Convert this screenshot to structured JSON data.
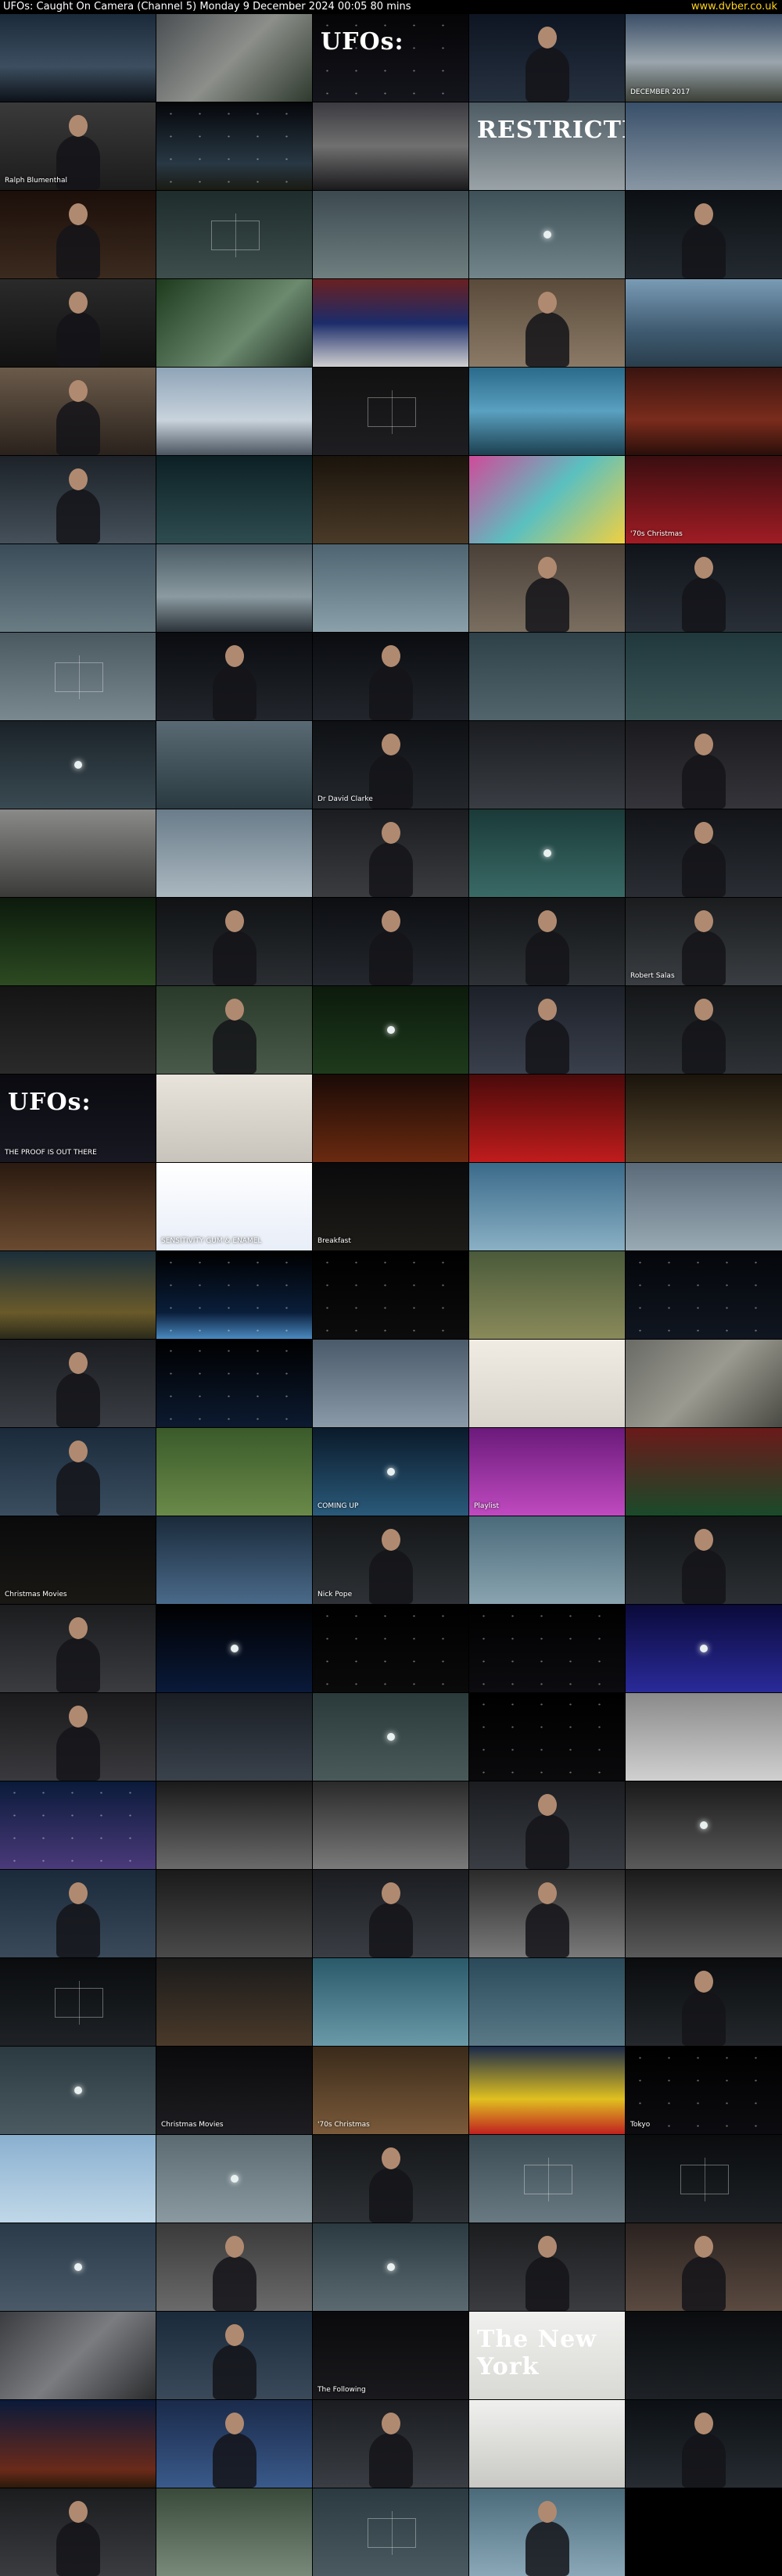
{
  "header": {
    "title": "UFOs: Caught On Camera (Channel 5)   Monday 9 December 2024  00:05  80 mins",
    "site": "www.dvber.co.uk"
  },
  "colors": {
    "background": "#000000",
    "site_link": "#ffd21e"
  },
  "thumbnails": [
    {
      "bg": "linear-gradient(#1b2a3a,#3c4e60 60%,#0d1218)"
    },
    {
      "bg": "linear-gradient(135deg,#4a4e52,#8c8f8a 50%,#2f3a2e)"
    },
    {
      "bg": "linear-gradient(#050507,#14141c)",
      "big": "UFOs:",
      "type": "stars"
    },
    {
      "bg": "linear-gradient(#0e1522,#263140)",
      "type": "person"
    },
    {
      "bg": "linear-gradient(#3a4e66,#9aa5ad 55%,#3b4036)",
      "cap": "DECEMBER 2017"
    },
    {
      "bg": "linear-gradient(#3a3a3a,#1c1c1c)",
      "type": "person",
      "cap": "Ralph Blumenthal"
    },
    {
      "bg": "linear-gradient(#05060a,#283844 70%,#1a1a12)",
      "type": "stars"
    },
    {
      "bg": "linear-gradient(#3a3a40,#707070 50%,#1a1a1d)"
    },
    {
      "bg": "linear-gradient(#4d5b63,#9aa3a7)",
      "big": "RESTRICTED"
    },
    {
      "bg": "linear-gradient(#39506a,#8997a4)"
    },
    {
      "bg": "linear-gradient(#1c0f0a,#3b2a1e)",
      "type": "person"
    },
    {
      "bg": "linear-gradient(#1e2c2c,#3d4e4c)",
      "type": "hud"
    },
    {
      "bg": "linear-gradient(#3c4a50,#6f7f80)"
    },
    {
      "bg": "linear-gradient(#3e5158,#71858a)",
      "type": "dot"
    },
    {
      "bg": "linear-gradient(#0c1014,#232a30)",
      "type": "person"
    },
    {
      "bg": "linear-gradient(#2a2a2a,#111)",
      "type": "person"
    },
    {
      "bg": "linear-gradient(135deg,#1d3a1d,#6b8a6e 60%,#1f2e22)"
    },
    {
      "bg": "linear-gradient(#6a2020,#1c2c6a 50%,#d0d0d0)"
    },
    {
      "bg": "linear-gradient(#5a4a3a,#8a7a66)",
      "type": "person"
    },
    {
      "bg": "linear-gradient(#7a9bb5,#3e5a70 60%,#2a3e4c)"
    },
    {
      "bg": "linear-gradient(#6a5a4a,#2a221c)",
      "type": "person"
    },
    {
      "bg": "linear-gradient(#8fa4b8,#c8d3dc 60%,#4a5560)"
    },
    {
      "bg": "linear-gradient(#111,#1e1e22)",
      "type": "hud"
    },
    {
      "bg": "linear-gradient(#2a6a8a,#5aa0c0 50%,#1c4050)"
    },
    {
      "bg": "linear-gradient(#3a1410,#7a2c1c 60%,#2a0e0a)"
    },
    {
      "bg": "linear-gradient(#1c2228,#45505a)",
      "type": "person"
    },
    {
      "bg": "linear-gradient(#0c2024,#2e4c50)"
    },
    {
      "bg": "linear-gradient(#1a140c,#4a3a28)"
    },
    {
      "bg": "linear-gradient(135deg,#d04a9a,#5ac0c0 50%,#f0d040)"
    },
    {
      "bg": "linear-gradient(#3a0e10,#a01c24)",
      "cap": "'70s Christmas"
    },
    {
      "bg": "linear-gradient(#3a4c58,#6a7c84)"
    },
    {
      "bg": "linear-gradient(#4a5a64,#8a9aa0 60%,#2c343a)"
    },
    {
      "bg": "linear-gradient(#4e6470,#8aa0aa)"
    },
    {
      "bg": "linear-gradient(#4a4038,#7a6e60)",
      "type": "person"
    },
    {
      "bg": "linear-gradient(#10141a,#2a3038)",
      "type": "person"
    },
    {
      "bg": "linear-gradient(#4a5860,#7a8890)",
      "type": "hud"
    },
    {
      "bg": "linear-gradient(#0a0c10,#22262c)",
      "type": "person"
    },
    {
      "bg": "linear-gradient(#0a0c10,#22262c)",
      "type": "person"
    },
    {
      "bg": "linear-gradient(#2e4048,#52646c)"
    },
    {
      "bg": "linear-gradient(#20383c,#3c5658)"
    },
    {
      "bg": "linear-gradient(#1a2228,#3a4a52)",
      "type": "dot"
    },
    {
      "bg": "linear-gradient(#5a6a74,#2a3a40)"
    },
    {
      "bg": "linear-gradient(#0e1014,#24282c)",
      "type": "person",
      "cap": "Dr David Clarke"
    },
    {
      "bg": "linear-gradient(#1a1c20,#3a3e44)"
    },
    {
      "bg": "linear-gradient(#1a1a1e,#34343a)",
      "type": "person"
    },
    {
      "bg": "linear-gradient(#8a8a88,#3a3a38)"
    },
    {
      "bg": "linear-gradient(#6a7c8a,#aab8c0)"
    },
    {
      "bg": "linear-gradient(#1a1c20,#3a3c40)",
      "type": "person"
    },
    {
      "bg": "linear-gradient(#1a3a38,#3a6a66)",
      "type": "dot"
    },
    {
      "bg": "linear-gradient(#121418,#2a2e34)",
      "type": "person"
    },
    {
      "bg": "linear-gradient(#0c1a0c,#2c4a22)"
    },
    {
      "bg": "linear-gradient(#101214,#2a2e32)",
      "type": "person"
    },
    {
      "bg": "linear-gradient(#0c0e12,#24282e)",
      "type": "person"
    },
    {
      "bg": "linear-gradient(#121416,#2e3236)",
      "type": "person"
    },
    {
      "bg": "linear-gradient(#1a1c1e,#3a3e42)",
      "type": "person",
      "cap": "Robert Salas"
    },
    {
      "bg": "linear-gradient(#141414,#2a2a2a)"
    },
    {
      "bg": "linear-gradient(#2a3a2a,#4a5a4a)",
      "type": "person"
    },
    {
      "bg": "linear-gradient(#0c1a0c,#1e3a1c)",
      "type": "dot"
    },
    {
      "bg": "linear-gradient(#1c2028,#3a404c)",
      "type": "person"
    },
    {
      "bg": "linear-gradient(#141618,#2e3236)",
      "type": "person"
    },
    {
      "bg": "linear-gradient(#0a0a10,#181822)",
      "big": "UFOs:",
      "cap": "THE PROOF IS OUT THERE"
    },
    {
      "bg": "linear-gradient(#e8e4dc,#c8c4bc)"
    },
    {
      "bg": "linear-gradient(#1a0a06,#6a2a10)"
    },
    {
      "bg": "linear-gradient(#4a0a0a,#c01c1c)"
    },
    {
      "bg": "linear-gradient(#1a140c,#5a4a30)"
    },
    {
      "bg": "linear-gradient(#2a1a10,#6a4a30)"
    },
    {
      "bg": "linear-gradient(#ffffff,#e8eef8)",
      "cap": "SENSITIVITY GUM & ENAMEL"
    },
    {
      "bg": "linear-gradient(#0a0a0c,#1e1c18)",
      "cap": "Breakfast"
    },
    {
      "bg": "linear-gradient(#3a6a8a,#8ab0c4)"
    },
    {
      "bg": "linear-gradient(#5a6a78,#9aaab4)"
    },
    {
      "bg": "linear-gradient(#1a2e3a,#6a5a2a 70%,#2a2a1a)"
    },
    {
      "bg": "linear-gradient(#000,#0a1e3a 70%,#4a8ac0)",
      "type": "stars"
    },
    {
      "bg": "linear-gradient(#000,#0c0c0c)",
      "type": "stars"
    },
    {
      "bg": "linear-gradient(#4a5a3a,#8a8a5a)"
    },
    {
      "bg": "linear-gradient(#04060a,#101620)",
      "type": "stars"
    },
    {
      "bg": "linear-gradient(#1a1c20,#3a3e44)",
      "type": "person"
    },
    {
      "bg": "linear-gradient(#000,#0c1a30)",
      "type": "stars"
    },
    {
      "bg": "linear-gradient(#4a5a6a,#8a9aa8)"
    },
    {
      "bg": "linear-gradient(#f0ece4,#d8d4cc)"
    },
    {
      "bg": "linear-gradient(135deg,#6a6a66,#9a9a90 50%,#4a4a44)"
    },
    {
      "bg": "linear-gradient(#1a2a3a,#3a4e60)",
      "type": "person"
    },
    {
      "bg": "linear-gradient(#3a5a2a,#6a8a4a)"
    },
    {
      "bg": "linear-gradient(#0a1a2a,#2a5a7a)",
      "type": "dot",
      "cap": "COMING UP"
    },
    {
      "bg": "linear-gradient(#6a1a7a,#c04ac0)",
      "cap": "Playlist"
    },
    {
      "bg": "linear-gradient(#6a1a1a,#1a4a2a)"
    },
    {
      "bg": "linear-gradient(#0a0a0c,#1a1814)",
      "cap": "Christmas Movies"
    },
    {
      "bg": "linear-gradient(#1a2a3a,#4a6a8a)"
    },
    {
      "bg": "linear-gradient(#141618,#2e3236)",
      "type": "person",
      "cap": "Nick Pope"
    },
    {
      "bg": "linear-gradient(#4a6a7a,#8aa4b0)"
    },
    {
      "bg": "linear-gradient(#121416,#2c3034)",
      "type": "person"
    },
    {
      "bg": "linear-gradient(#1a1c1e,#3a3c40)",
      "type": "person"
    },
    {
      "bg": "linear-gradient(#000,#0a1a3a)",
      "type": "dot"
    },
    {
      "bg": "linear-gradient(#000,#0a0a0a)",
      "type": "stars"
    },
    {
      "bg": "linear-gradient(#000,#0c0c10)",
      "type": "stars"
    },
    {
      "bg": "linear-gradient(#0a0a3a,#2a2a9a)",
      "type": "dot"
    },
    {
      "bg": "linear-gradient(#1a1a1c,#3a3a3e)",
      "type": "person"
    },
    {
      "bg": "linear-gradient(#1a1e24,#3a424c)"
    },
    {
      "bg": "linear-gradient(#2a3a3a,#4a5a5a)",
      "type": "dot"
    },
    {
      "bg": "linear-gradient(#000,#0a0a0c)",
      "type": "stars"
    },
    {
      "bg": "linear-gradient(#8a8a8a,#d0d0d0)"
    },
    {
      "bg": "linear-gradient(#0a1a3a,#4a3a7a)",
      "type": "stars"
    },
    {
      "bg": "linear-gradient(#1a1a1a,#6a6a6a)"
    },
    {
      "bg": "linear-gradient(#2a2a2a,#7a7a7a)"
    },
    {
      "bg": "linear-gradient(#1a1c20,#3a3e44)",
      "type": "person"
    },
    {
      "bg": "linear-gradient(#1a1a1a,#5a5a5a)",
      "type": "dot"
    },
    {
      "bg": "linear-gradient(#1a2a3a,#3a4a5a)",
      "type": "person"
    },
    {
      "bg": "linear-gradient(#1a1a1a,#4a4a4a)"
    },
    {
      "bg": "linear-gradient(#1a1c20,#3a3e44)",
      "type": "person"
    },
    {
      "bg": "linear-gradient(#2a2a2a,#7a7a7a)",
      "type": "person"
    },
    {
      "bg": "linear-gradient(#1a1a1a,#5a5a5a)"
    },
    {
      "bg": "linear-gradient(#0a0c0e,#1e2226)",
      "type": "hud"
    },
    {
      "bg": "linear-gradient(#1a1a1a,#4a3a2a)"
    },
    {
      "bg": "linear-gradient(#2a5a6a,#6a9aa8)"
    },
    {
      "bg": "linear-gradient(#2a4a5a,#5a7a88)"
    },
    {
      "bg": "linear-gradient(#0a0c0e,#24282c)",
      "type": "person"
    },
    {
      "bg": "linear-gradient(#2a3a40,#4a5a60)",
      "type": "dot"
    },
    {
      "bg": "linear-gradient(#0a0a0c,#1e1e22)",
      "cap": "Christmas Movies"
    },
    {
      "bg": "linear-gradient(#3a2a1a,#7a5a3a)",
      "cap": "'70s Christmas"
    },
    {
      "bg": "linear-gradient(#1a2a4a,#e0c020 60%,#c02020)"
    },
    {
      "bg": "linear-gradient(#000,#0c0c10)",
      "type": "stars",
      "cap": "Tokyo"
    },
    {
      "bg": "linear-gradient(#8ab0d0,#c0d8e8)"
    },
    {
      "bg": "linear-gradient(#5a6a70,#8a9aa0)",
      "type": "dot"
    },
    {
      "bg": "linear-gradient(#141618,#2e3236)",
      "type": "person"
    },
    {
      "bg": "linear-gradient(#3a4a52,#6a7a82)",
      "type": "hud"
    },
    {
      "bg": "linear-gradient(#0a0c0e,#1e2226)",
      "type": "hud"
    },
    {
      "bg": "linear-gradient(#2a3a48,#4a5a68)",
      "type": "dot"
    },
    {
      "bg": "linear-gradient(#3a3a3a,#6a6a6a)",
      "type": "person"
    },
    {
      "bg": "linear-gradient(#2a3a40,#5a6a70)",
      "type": "dot"
    },
    {
      "bg": "linear-gradient(#1a1c1e,#3a3c40)",
      "type": "person"
    },
    {
      "bg": "linear-gradient(#2a2220,#5a4a40)",
      "type": "person"
    },
    {
      "bg": "linear-gradient(135deg,#3a3c40,#7a7c80 50%,#2a2c2e)"
    },
    {
      "bg": "linear-gradient(#1a2a3a,#3a4a5a)",
      "type": "person"
    },
    {
      "bg": "linear-gradient(#0a0a0c,#1a1a1e)",
      "cap": "The Following"
    },
    {
      "bg": "linear-gradient(#f0f0ee,#d8d8d4)",
      "big": "The New York"
    },
    {
      "bg": "linear-gradient(#0a0c0e,#1e2226)"
    },
    {
      "bg": "linear-gradient(#0a1a3a,#6a2a1a 80%,#2a1a0a)"
    },
    {
      "bg": "linear-gradient(#1a2a4a,#3a5a8a)",
      "type": "person"
    },
    {
      "bg": "linear-gradient(#1a1c20,#3a3e44)",
      "type": "person"
    },
    {
      "bg": "linear-gradient(#f0f0ee,#c8c8c4)"
    },
    {
      "bg": "linear-gradient(#0c1014,#262c32)",
      "type": "person"
    },
    {
      "bg": "linear-gradient(#1a1c1e,#3a3c40)",
      "type": "person"
    },
    {
      "bg": "linear-gradient(#3a4a3a,#7a8a7a)"
    },
    {
      "bg": "linear-gradient(#2a3a40,#4a5a60)",
      "type": "hud"
    },
    {
      "bg": "linear-gradient(#4a6a7a,#8aa8b8)",
      "type": "person"
    }
  ]
}
